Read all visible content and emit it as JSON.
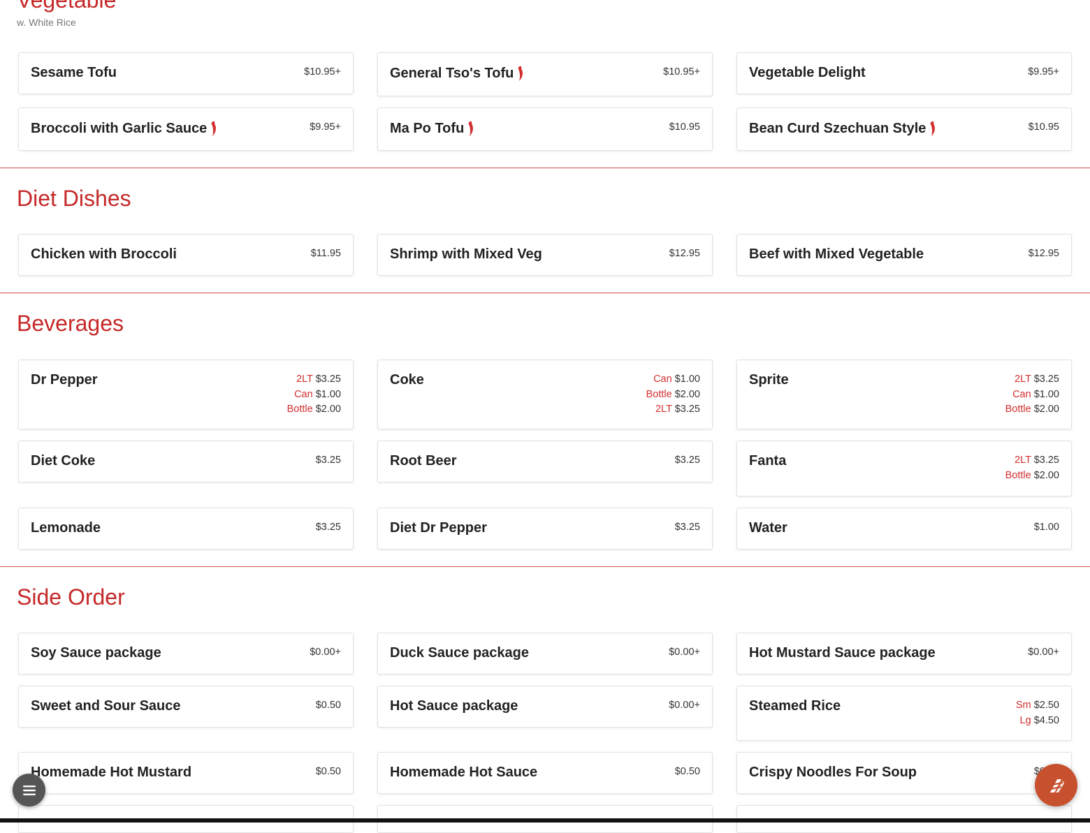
{
  "colors": {
    "accent": "#c62828",
    "chili": "#d32f2f",
    "fab": "#c7502e"
  },
  "sections": {
    "vegetable": {
      "title": "Vegetable",
      "subtitle": "w. White Rice",
      "items": [
        {
          "name": "Sesame Tofu",
          "price": "$10.95+"
        },
        {
          "name": "General Tso's Tofu",
          "price": "$10.95+",
          "spicy": true
        },
        {
          "name": "Vegetable Delight",
          "price": "$9.95+"
        },
        {
          "name": "Broccoli with Garlic Sauce",
          "price": "$9.95+",
          "spicy": true
        },
        {
          "name": "Ma Po Tofu",
          "price": "$10.95",
          "spicy": true
        },
        {
          "name": "Bean Curd Szechuan Style",
          "price": "$10.95",
          "spicy": true
        }
      ]
    },
    "diet": {
      "title": "Diet Dishes",
      "items": [
        {
          "name": "Chicken with Broccoli",
          "price": "$11.95"
        },
        {
          "name": "Shrimp with Mixed Veg",
          "price": "$12.95"
        },
        {
          "name": "Beef with Mixed Vegetable",
          "price": "$12.95"
        }
      ]
    },
    "beverages": {
      "title": "Beverages",
      "items": [
        {
          "name": "Dr Pepper",
          "prices": [
            {
              "label": "2LT",
              "price": "$3.25"
            },
            {
              "label": "Can",
              "price": "$1.00"
            },
            {
              "label": "Bottle",
              "price": "$2.00"
            }
          ]
        },
        {
          "name": "Coke",
          "prices": [
            {
              "label": "Can",
              "price": "$1.00"
            },
            {
              "label": "Bottle",
              "price": "$2.00"
            },
            {
              "label": "2LT",
              "price": "$3.25"
            }
          ]
        },
        {
          "name": "Sprite",
          "prices": [
            {
              "label": "2LT",
              "price": "$3.25"
            },
            {
              "label": "Can",
              "price": "$1.00"
            },
            {
              "label": "Bottle",
              "price": "$2.00"
            }
          ]
        },
        {
          "name": "Diet Coke",
          "price": "$3.25"
        },
        {
          "name": "Root Beer",
          "price": "$3.25"
        },
        {
          "name": "Fanta",
          "prices": [
            {
              "label": "2LT",
              "price": "$3.25"
            },
            {
              "label": "Bottle",
              "price": "$2.00"
            }
          ]
        },
        {
          "name": "Lemonade",
          "price": "$3.25"
        },
        {
          "name": "Diet Dr Pepper",
          "price": "$3.25"
        },
        {
          "name": "Water",
          "price": "$1.00"
        }
      ]
    },
    "side": {
      "title": "Side Order",
      "items": [
        {
          "name": "Soy Sauce package",
          "price": "$0.00+"
        },
        {
          "name": "Duck Sauce package",
          "price": "$0.00+"
        },
        {
          "name": "Hot Mustard Sauce package",
          "price": "$0.00+"
        },
        {
          "name": "Sweet and Sour Sauce",
          "price": "$0.50"
        },
        {
          "name": "Hot Sauce package",
          "price": "$0.00+"
        },
        {
          "name": "Steamed Rice",
          "prices": [
            {
              "label": "Sm",
              "price": "$2.50"
            },
            {
              "label": "Lg",
              "price": "$4.50"
            }
          ]
        },
        {
          "name": "Homemade Hot Mustard",
          "price": "$0.50"
        },
        {
          "name": "Homemade Hot Sauce",
          "price": "$0.50"
        },
        {
          "name": "Crispy Noodles For Soup",
          "price": "$0.50"
        }
      ]
    }
  },
  "floating": {
    "menu_icon": "menu-icon",
    "order_icon": "order-icon"
  }
}
